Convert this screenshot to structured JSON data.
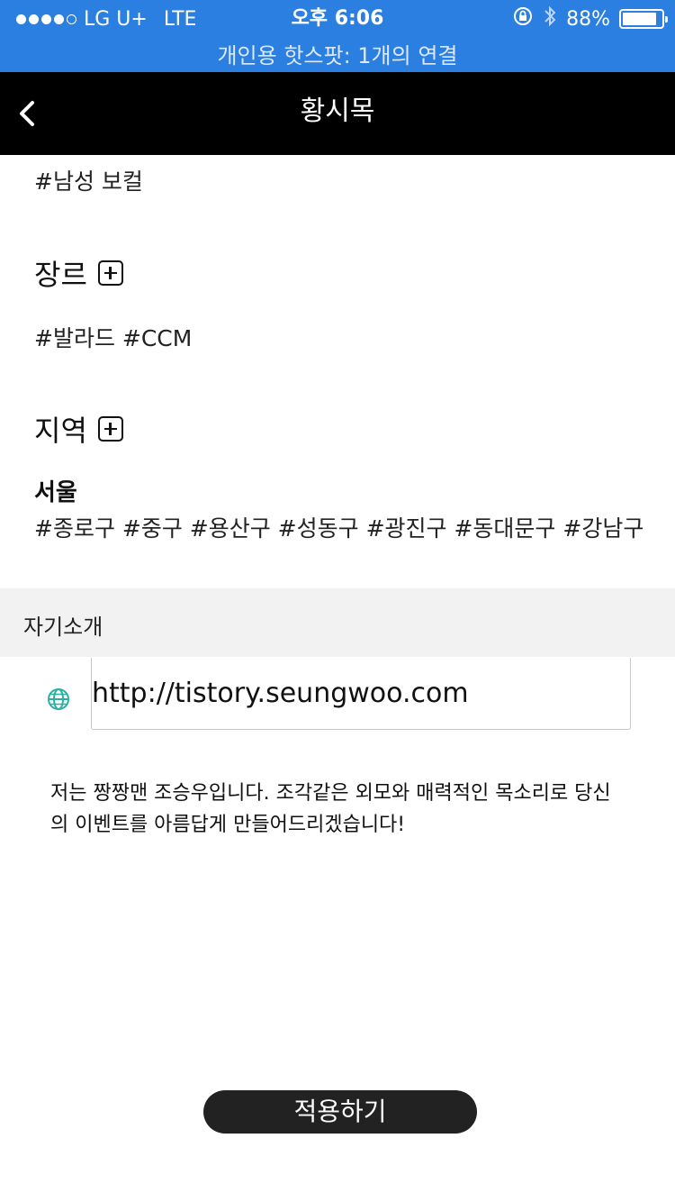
{
  "status_bar": {
    "carrier": "LG U+",
    "network": "LTE",
    "time": "오후 6:06",
    "battery_text": "88%",
    "battery_level": 0.88,
    "hotspot_text": "개인용 핫스팟: 1개의 연결",
    "signal_dots_filled": 4,
    "signal_dots_total": 5
  },
  "nav": {
    "title": "황시목",
    "back_icon": "chevron-left-icon"
  },
  "voice_tags": "#남성 보컬",
  "genre": {
    "title": "장르",
    "add_icon": "plus-box-icon",
    "tags": "#발라드  #CCM"
  },
  "region": {
    "title": "지역",
    "add_icon": "plus-box-icon",
    "city": "서울",
    "districts": "#종로구 #중구 #용산구 #성동구 #광진구 #동대문구 #강남구"
  },
  "intro": {
    "label": "자기소개",
    "url_icon": "globe-icon",
    "url_value": "http://tistory.seungwoo.com",
    "text": "저는 짱짱맨 조승우입니다. 조각같은 외모와 매력적인 목소리로 당신의 이벤트를 아름답게 만들어드리겠습니다!"
  },
  "apply_button": "적용하기",
  "colors": {
    "status_bar_bg": "#2a7fe0",
    "nav_bg": "#000000",
    "globe": "#2ab0a0",
    "button_bg": "#222222",
    "section_bg": "#f2f2f2"
  }
}
